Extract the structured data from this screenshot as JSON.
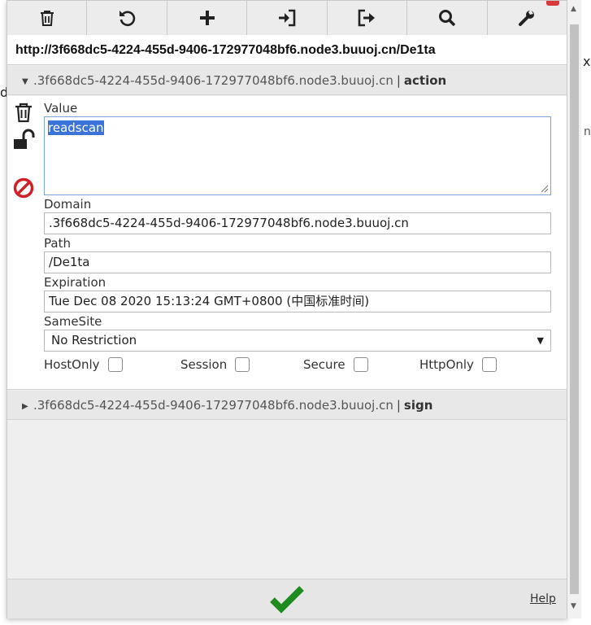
{
  "background": {
    "edge_chars": [
      "d",
      "x",
      "n/"
    ]
  },
  "toolbar": {
    "buttons": [
      {
        "name": "delete-all",
        "icon": "trash-icon"
      },
      {
        "name": "reset",
        "icon": "undo-icon"
      },
      {
        "name": "add",
        "icon": "plus-icon"
      },
      {
        "name": "import",
        "icon": "import-icon"
      },
      {
        "name": "export",
        "icon": "export-icon"
      },
      {
        "name": "search",
        "icon": "search-icon"
      },
      {
        "name": "options",
        "icon": "wrench-icon"
      }
    ]
  },
  "url": "http://3f668dc5-4224-455d-9406-172977048bf6.node3.buuoj.cn/De1ta",
  "cookies": [
    {
      "domain": ".3f668dc5-4224-455d-9406-172977048bf6.node3.buuoj.cn",
      "separator": "|",
      "name": "action",
      "expanded": true
    },
    {
      "domain": ".3f668dc5-4224-455d-9406-172977048bf6.node3.buuoj.cn",
      "separator": "|",
      "name": "sign",
      "expanded": false
    }
  ],
  "editor": {
    "value_label": "Value",
    "value": "readscan",
    "domain_label": "Domain",
    "domain": ".3f668dc5-4224-455d-9406-172977048bf6.node3.buuoj.cn",
    "path_label": "Path",
    "path": "/De1ta",
    "expiration_label": "Expiration",
    "expiration": "Tue Dec 08 2020 15:13:24 GMT+0800 (中国标准时间)",
    "samesite_label": "SameSite",
    "samesite": "No Restriction",
    "flags": [
      {
        "label": "HostOnly",
        "checked": false
      },
      {
        "label": "Session",
        "checked": false
      },
      {
        "label": "Secure",
        "checked": false
      },
      {
        "label": "HttpOnly",
        "checked": false
      }
    ]
  },
  "footer": {
    "help_label": "Help"
  },
  "colors": {
    "accent_green": "#1f8a1f",
    "block_red": "#d0202a",
    "selection_blue": "#3b74d8"
  }
}
